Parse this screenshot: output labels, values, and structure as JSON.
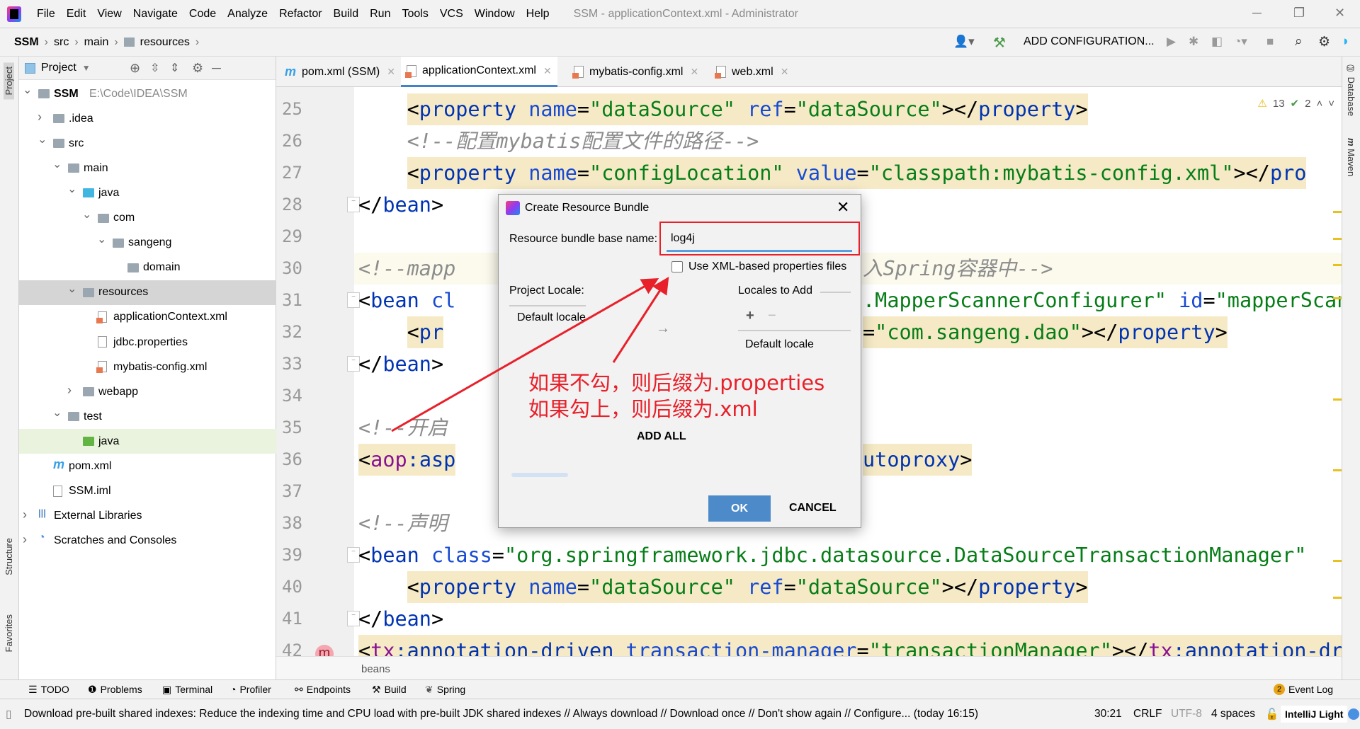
{
  "window": {
    "title": "SSM - applicationContext.xml - Administrator",
    "menu": [
      "File",
      "Edit",
      "View",
      "Navigate",
      "Code",
      "Analyze",
      "Refactor",
      "Build",
      "Run",
      "Tools",
      "VCS",
      "Window",
      "Help"
    ]
  },
  "breadcrumb": [
    "SSM",
    "src",
    "main",
    "resources"
  ],
  "toolbar": {
    "add_configuration": "ADD CONFIGURATION..."
  },
  "project": {
    "title": "Project",
    "tree": [
      {
        "label": "SSM",
        "extra": "E:\\Code\\IDEA\\SSM",
        "level": 0,
        "state": "open",
        "icon": "module",
        "bold": true
      },
      {
        "label": ".idea",
        "level": 1,
        "state": "closed",
        "icon": "folder"
      },
      {
        "label": "src",
        "level": 1,
        "state": "open",
        "icon": "folder"
      },
      {
        "label": "main",
        "level": 2,
        "state": "open",
        "icon": "folder"
      },
      {
        "label": "java",
        "level": 3,
        "state": "open",
        "icon": "folder-blue"
      },
      {
        "label": "com",
        "level": 4,
        "state": "open",
        "icon": "folder"
      },
      {
        "label": "sangeng",
        "level": 5,
        "state": "open",
        "icon": "folder"
      },
      {
        "label": "domain",
        "level": 6,
        "state": "none",
        "icon": "folder"
      },
      {
        "label": "resources",
        "level": 3,
        "state": "open",
        "icon": "folder",
        "selected": true
      },
      {
        "label": "applicationContext.xml",
        "level": 4,
        "state": "none",
        "icon": "xml-file"
      },
      {
        "label": "jdbc.properties",
        "level": 4,
        "state": "none",
        "icon": "file"
      },
      {
        "label": "mybatis-config.xml",
        "level": 4,
        "state": "none",
        "icon": "xml-file"
      },
      {
        "label": "webapp",
        "level": 3,
        "state": "closed",
        "icon": "folder"
      },
      {
        "label": "test",
        "level": 2,
        "state": "open",
        "icon": "folder"
      },
      {
        "label": "java",
        "level": 3,
        "state": "none",
        "icon": "folder-green",
        "highlight": true
      },
      {
        "label": "pom.xml",
        "level": 1,
        "state": "none",
        "icon": "maven"
      },
      {
        "label": "SSM.iml",
        "level": 1,
        "state": "none",
        "icon": "file"
      },
      {
        "label": "External Libraries",
        "level": 0,
        "state": "closed",
        "icon": "library"
      },
      {
        "label": "Scratches and Consoles",
        "level": 0,
        "state": "closed",
        "icon": "scratch"
      }
    ]
  },
  "tabs": [
    {
      "label": "pom.xml (SSM)",
      "icon": "maven"
    },
    {
      "label": "applicationContext.xml",
      "icon": "spring-xml",
      "active": true
    },
    {
      "label": "mybatis-config.xml",
      "icon": "xml"
    },
    {
      "label": "web.xml",
      "icon": "xml"
    }
  ],
  "inspections": {
    "warnings": "13",
    "weak": "2"
  },
  "code": [
    {
      "n": "25",
      "indent": 2,
      "hl": true,
      "segs": [
        [
          "<",
          "p"
        ],
        [
          "property",
          "t"
        ],
        [
          " name",
          "a"
        ],
        [
          "=",
          "p"
        ],
        [
          "\"dataSource\"",
          "s"
        ],
        [
          " ref",
          "a"
        ],
        [
          "=",
          "p"
        ],
        [
          "\"dataSource\"",
          "s"
        ],
        [
          "></",
          "p"
        ],
        [
          "property",
          "t"
        ],
        [
          ">",
          "p"
        ]
      ]
    },
    {
      "n": "26",
      "indent": 2,
      "segs": [
        [
          "<!--配置mybatis配置文件的路径-->",
          "c"
        ]
      ]
    },
    {
      "n": "27",
      "indent": 2,
      "hl": true,
      "segs": [
        [
          "<",
          "p"
        ],
        [
          "property",
          "t"
        ],
        [
          " name",
          "a"
        ],
        [
          "=",
          "p"
        ],
        [
          "\"configLocation\"",
          "s"
        ],
        [
          " value",
          "a"
        ],
        [
          "=",
          "p"
        ],
        [
          "\"classpath:mybatis-config.xml\"",
          "s"
        ],
        [
          "></",
          "p"
        ],
        [
          "pro",
          "t"
        ]
      ]
    },
    {
      "n": "28",
      "indent": 1,
      "segs": [
        [
          "</",
          "p"
        ],
        [
          "bean",
          "t"
        ],
        [
          ">",
          "p"
        ]
      ]
    },
    {
      "n": "29",
      "indent": 0,
      "segs": []
    },
    {
      "n": "30",
      "indent": 1,
      "cur": true,
      "segs": [
        [
          "<!--mapp",
          "c"
        ]
      ],
      "right": [
        [
          "入Spring容器中-->",
          "c"
        ]
      ]
    },
    {
      "n": "31",
      "indent": 1,
      "segs": [
        [
          "<",
          "p"
        ],
        [
          "bean",
          "t"
        ],
        [
          " cl",
          "a"
        ]
      ],
      "right": [
        [
          ".MapperScannerConfigurer\"",
          "s"
        ],
        [
          " id",
          "a"
        ],
        [
          "=",
          "p"
        ],
        [
          "\"mapperScan",
          "s"
        ]
      ]
    },
    {
      "n": "32",
      "indent": 2,
      "hl": true,
      "segs": [
        [
          "<",
          "p"
        ],
        [
          "pr",
          "t"
        ]
      ],
      "right": [
        [
          "=",
          "p"
        ],
        [
          "\"com.sangeng.dao\"",
          "s"
        ],
        [
          "></",
          "p"
        ],
        [
          "property",
          "t"
        ],
        [
          ">",
          "p"
        ]
      ],
      "right_hl": true
    },
    {
      "n": "33",
      "indent": 1,
      "segs": [
        [
          "</",
          "p"
        ],
        [
          "bean",
          "t"
        ],
        [
          ">",
          "p"
        ]
      ]
    },
    {
      "n": "34",
      "indent": 0,
      "segs": []
    },
    {
      "n": "35",
      "indent": 1,
      "segs": [
        [
          "<!--开启",
          "c"
        ]
      ]
    },
    {
      "n": "36",
      "indent": 1,
      "hl": true,
      "segs": [
        [
          "<",
          "p"
        ],
        [
          "aop",
          "n"
        ],
        [
          ":asp",
          "t"
        ]
      ],
      "right": [
        [
          "utoproxy",
          "t"
        ],
        [
          ">",
          "p"
        ]
      ],
      "right_hl": true
    },
    {
      "n": "37",
      "indent": 0,
      "segs": []
    },
    {
      "n": "38",
      "indent": 1,
      "segs": [
        [
          "<!--声明",
          "c"
        ]
      ]
    },
    {
      "n": "39",
      "indent": 1,
      "segs": [
        [
          "<",
          "p"
        ],
        [
          "bean",
          "t"
        ],
        [
          " class",
          "a"
        ],
        [
          "=",
          "p"
        ],
        [
          "\"org.springframework.jdbc.datasource.DataSourceTransactionManager\"",
          "s"
        ]
      ]
    },
    {
      "n": "40",
      "indent": 2,
      "hl": true,
      "segs": [
        [
          "<",
          "p"
        ],
        [
          "property",
          "t"
        ],
        [
          " name",
          "a"
        ],
        [
          "=",
          "p"
        ],
        [
          "\"dataSource\"",
          "s"
        ],
        [
          " ref",
          "a"
        ],
        [
          "=",
          "p"
        ],
        [
          "\"dataSource\"",
          "s"
        ],
        [
          "></",
          "p"
        ],
        [
          "property",
          "t"
        ],
        [
          ">",
          "p"
        ]
      ]
    },
    {
      "n": "41",
      "indent": 1,
      "segs": [
        [
          "</",
          "p"
        ],
        [
          "bean",
          "t"
        ],
        [
          ">",
          "p"
        ]
      ]
    },
    {
      "n": "42",
      "indent": 1,
      "hl": true,
      "segs": [
        [
          "<",
          "p"
        ],
        [
          "tx",
          "n"
        ],
        [
          ":annotation-driven",
          "t"
        ],
        [
          " transaction-manager",
          "a"
        ],
        [
          "=",
          "p"
        ],
        [
          "\"transactionManager\"",
          "s"
        ],
        [
          "></",
          "p"
        ],
        [
          "tx",
          "n"
        ],
        [
          ":annotation-driven",
          "t"
        ],
        [
          ">",
          "p"
        ]
      ]
    }
  ],
  "editor_breadcrumb": "beans",
  "side": {
    "left_top": "Project",
    "left_mid": "Structure",
    "left_bottom": "Favorites",
    "right_top": "Database",
    "right_mid": "Maven"
  },
  "toolwindows": [
    "TODO",
    "Problems",
    "Terminal",
    "Profiler",
    "Endpoints",
    "Build",
    "Spring"
  ],
  "event_log": {
    "label": "Event Log",
    "count": "2"
  },
  "status": {
    "message": "Download pre-built shared indexes: Reduce the indexing time and CPU load with pre-built JDK shared indexes // Always download // Download once // Don't show again // Configure... (today 16:15)",
    "position": "30:21",
    "line_sep": "CRLF",
    "encoding": "UTF-8",
    "indent": "4 spaces",
    "theme": "IntelliJ Light"
  },
  "dialog": {
    "title": "Create Resource Bundle",
    "base_name_label": "Resource bundle base name:",
    "base_name_value": "log4j",
    "xml_checkbox_label": "Use XML-based properties files",
    "xml_checked": false,
    "project_locales": "Project Locale:",
    "project_default": "Default locale",
    "locales_to_add": "Locales to Add",
    "add_default": "Default locale",
    "add_all": "ADD ALL",
    "ok": "OK",
    "cancel": "CANCEL"
  },
  "annotation": {
    "line1": "如果不勾，则后缀为.properties",
    "line2": "如果勾上，则后缀为.xml",
    "color": "#e8202a"
  }
}
